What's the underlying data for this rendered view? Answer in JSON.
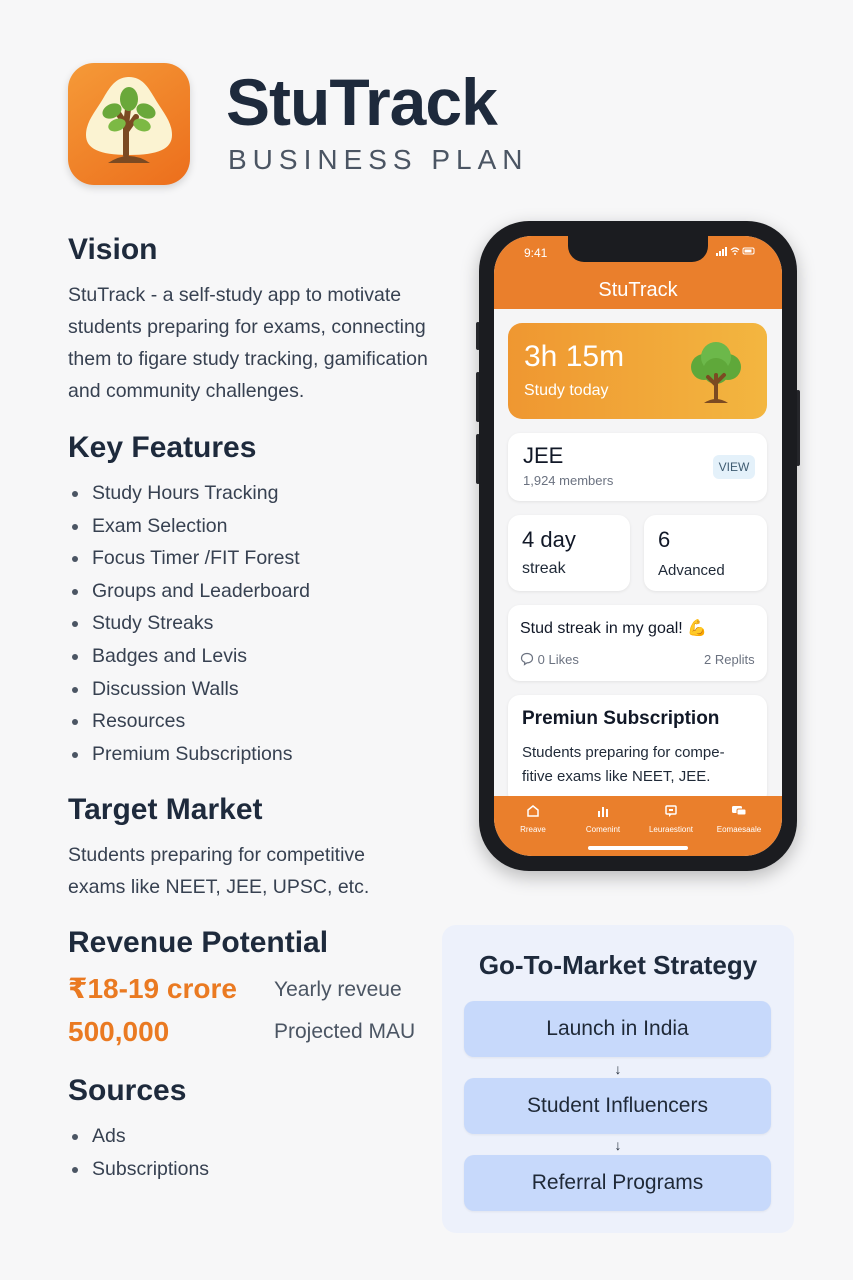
{
  "header": {
    "brand": "StuTrack",
    "subtitle": "BUSINESS PLAN",
    "logo_icon": "tree-icon"
  },
  "vision": {
    "heading": "Vision",
    "text_lines": [
      "StuTrack - a self-study app to motivate",
      "students preparing for exams, connecting",
      "them to figare study tracking, gamification",
      "and community challenges."
    ]
  },
  "features": {
    "heading": "Key Features",
    "items": [
      "Study Hours Tracking",
      "Exam Selection",
      "Focus Timer /FIT Forest",
      "Groups and Leaderboard",
      "Study Streaks",
      "Badges and Levis",
      "Discussion Walls",
      "Resources",
      "Premium Subscriptions"
    ]
  },
  "target_market": {
    "heading": "Target Market",
    "text_lines": [
      "Students preparing for competitive",
      "exams like NEET, JEE, UPSC, etc."
    ]
  },
  "revenue": {
    "heading": "Revenue Potential",
    "rows": [
      {
        "value": "₹18-19 crore",
        "label": "Yearly reveue"
      },
      {
        "value": "500,000",
        "label": "Projected MAU"
      }
    ],
    "accent_color": "#ea7a22"
  },
  "sources": {
    "heading": "Sources",
    "items": [
      "Ads",
      "Subscriptions"
    ]
  },
  "phone": {
    "status_time": "9:41",
    "status_icons": "signal-wifi-battery-icons",
    "app_title": "StuTrack",
    "study_card": {
      "time": "3h 15m",
      "label": "Study today",
      "icon": "tree-icon"
    },
    "group_card": {
      "title": "JEE",
      "members": "1,924 members",
      "button": "VIEW"
    },
    "streak_card": {
      "number": "4 day",
      "label": "streak"
    },
    "advanced_card": {
      "number": "6",
      "label": "Advanced"
    },
    "post_card": {
      "text": "Stud streak in my goal! 💪",
      "likes": "0 Likes",
      "replies": "2 Replits"
    },
    "premium_card": {
      "title": "Premiun Subscription",
      "text_lines": [
        "Students preparing for compe-",
        "fitive exams like NEET, JEE."
      ]
    },
    "tabs": [
      {
        "label": "Rreave",
        "icon": "home-icon"
      },
      {
        "label": "Comenint",
        "icon": "chart-icon"
      },
      {
        "label": "Leuraestiont",
        "icon": "message-icon"
      },
      {
        "label": "Eomaesaale",
        "icon": "chat-icon"
      }
    ],
    "brand_color": "#ea7f2c"
  },
  "gtm": {
    "heading": "Go-To-Market Strategy",
    "steps": [
      "Launch in India",
      "Student Influencers",
      "Referral Programs"
    ],
    "arrow": "↓"
  }
}
